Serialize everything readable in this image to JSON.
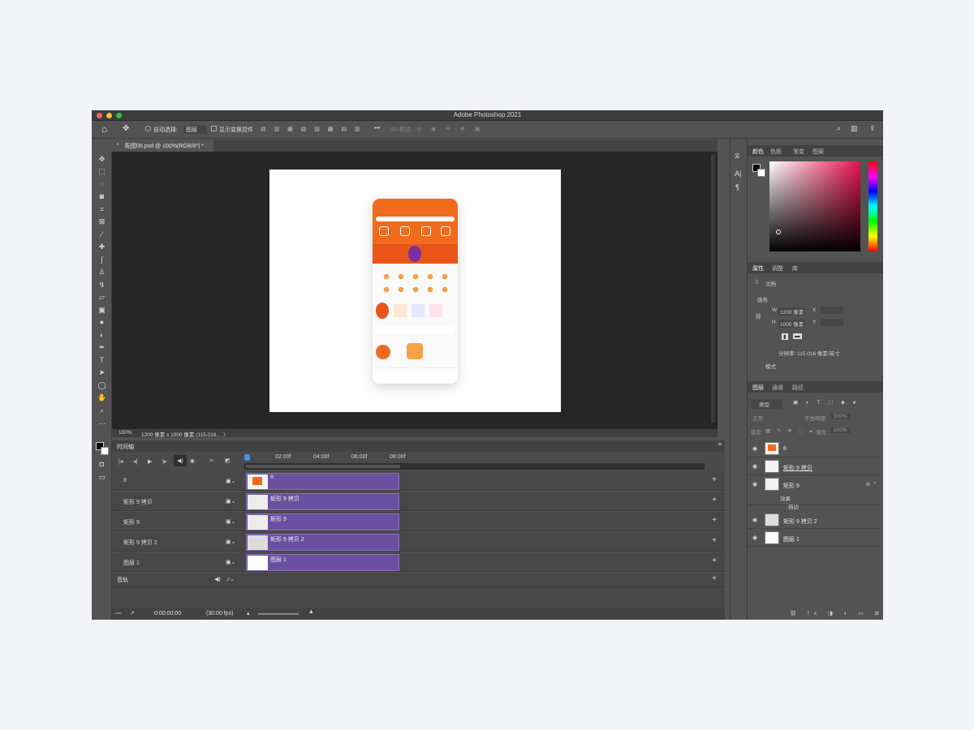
{
  "app": {
    "title": "Adobe Photoshop 2021"
  },
  "options_bar": {
    "auto_select_label": "自动选择:",
    "auto_select_value": "图层",
    "show_transform_label": "显示变换控件",
    "mode_3d_label": "3D 模式:"
  },
  "document_tab": {
    "label": "配图08.psd @ 100%(RGB/8*) *"
  },
  "status": {
    "zoom": "100%",
    "info": "1200 像素 x 1000 像素 (115.016...",
    "more": "〉"
  },
  "timeline": {
    "panel_title": "时间轴",
    "ruler": [
      "02:00f",
      "04:00f",
      "06:00f",
      "08:00f"
    ],
    "tracks": [
      {
        "name": "8",
        "clip_label": "8"
      },
      {
        "name": "矩形 9 拷贝",
        "clip_label": "矩形 9 拷贝"
      },
      {
        "name": "矩形 9",
        "clip_label": "矩形 9"
      },
      {
        "name": "矩形 9 拷贝 2",
        "clip_label": "矩形 9 拷贝 2"
      },
      {
        "name": "图层 1",
        "clip_label": "图层 1"
      }
    ],
    "audio_track": "音轨",
    "timecode": "0:00:00:00",
    "fps": "(30.00 fps)"
  },
  "color_panel": {
    "tabs": [
      "颜色",
      "色板",
      "渐变",
      "图案"
    ]
  },
  "properties_panel": {
    "tabs": [
      "属性",
      "调整",
      "库"
    ],
    "doc_label": "文档",
    "canvas_label": "画布",
    "w_label": "W",
    "w_value": "1200 像素",
    "h_label": "H",
    "h_value": "1000 像素",
    "x_label": "X",
    "y_label": "Y",
    "resolution": "分辨率: 115.016 像素/英寸",
    "mode_label": "模式"
  },
  "layers_panel": {
    "tabs": [
      "图层",
      "通道",
      "路径"
    ],
    "filter_label": "类型",
    "blend_mode": "正常",
    "opacity_label": "不透明度:",
    "opacity_value": "100%",
    "lock_label": "锁定:",
    "fill_label": "填充:",
    "fill_value": "100%",
    "layers": [
      {
        "name": "8"
      },
      {
        "name": "矩形 9 拷贝"
      },
      {
        "name": "矩形 9"
      },
      {
        "name": "矩形 9 拷贝 2"
      },
      {
        "name": "图层 1"
      }
    ],
    "effects_label": "效果",
    "stroke_label": "描边"
  },
  "colors": {
    "clip": "#6b4fa0",
    "canvas": "#262626",
    "panel": "#535353",
    "orange": "#f26b1d"
  }
}
